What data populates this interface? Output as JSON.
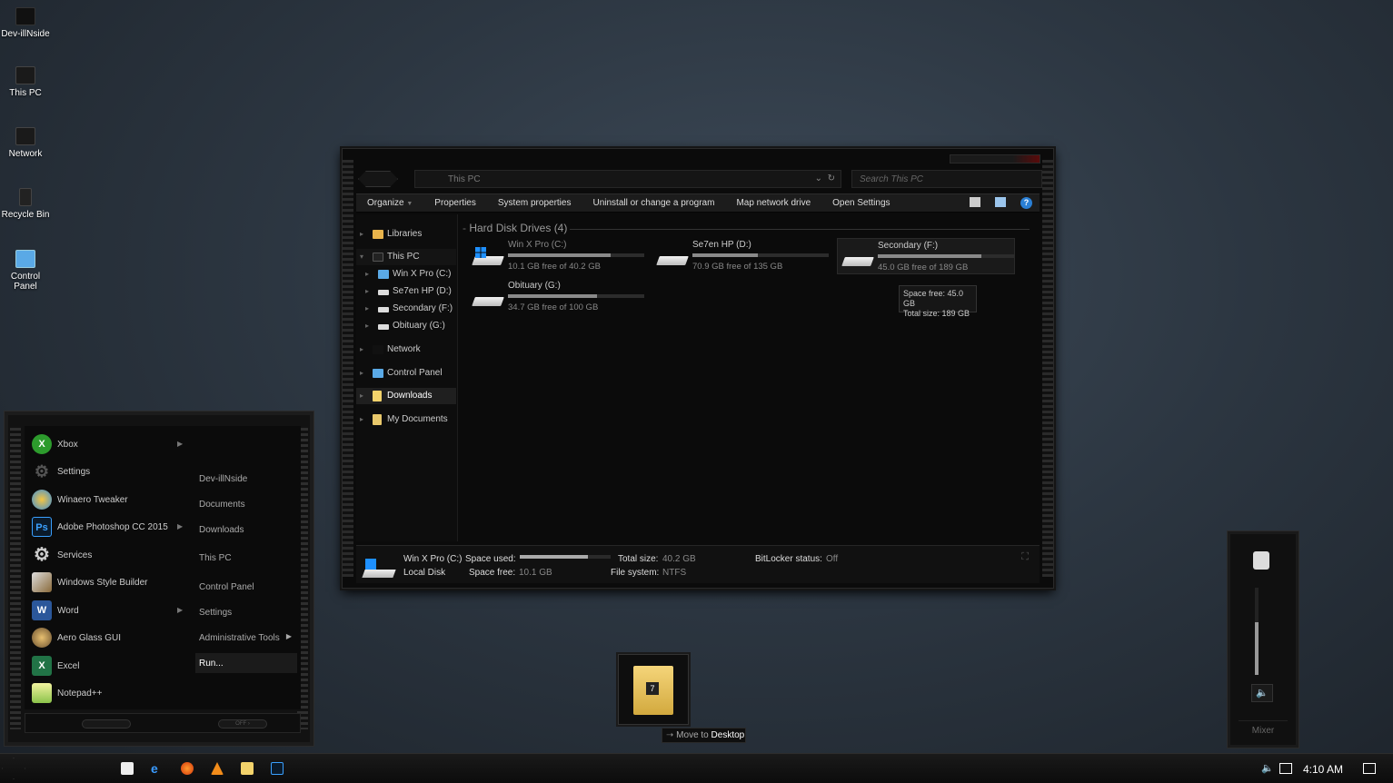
{
  "desktop_icons": [
    {
      "label": "Dev-illNside"
    },
    {
      "label": "This PC"
    },
    {
      "label": "Network"
    },
    {
      "label": "Recycle Bin"
    },
    {
      "label": "Control Panel"
    }
  ],
  "explorer": {
    "address": "This PC",
    "search_placeholder": "Search This PC",
    "toolbar": {
      "organize": "Organize",
      "properties": "Properties",
      "system_properties": "System properties",
      "uninstall": "Uninstall or change a program",
      "map_drive": "Map network drive",
      "open_settings": "Open Settings"
    },
    "nav": {
      "libraries": "Libraries",
      "this_pc": "This PC",
      "drive_c": "Win X Pro (C:)",
      "drive_d": "Se7en HP (D:)",
      "drive_f": "Secondary (F:)",
      "drive_g": "Obituary (G:)",
      "network": "Network",
      "control_panel": "Control Panel",
      "downloads": "Downloads",
      "my_documents": "My Documents"
    },
    "group_title": "Hard Disk Drives (4)",
    "drives": [
      {
        "name": "Win X Pro (C:)",
        "free_text": "10.1 GB free of 40.2 GB",
        "used_fraction": 0.75
      },
      {
        "name": "Se7en HP (D:)",
        "free_text": "70.9 GB free of 135 GB",
        "used_fraction": 0.48
      },
      {
        "name": "Secondary (F:)",
        "free_text": "45.0 GB free of 189 GB",
        "used_fraction": 0.76
      },
      {
        "name": "Obituary (G:)",
        "free_text": "34.7 GB free of 100 GB",
        "used_fraction": 0.65
      }
    ],
    "tooltip": {
      "line1": "Space free: 45.0 GB",
      "line2": "Total size: 189 GB"
    },
    "details": {
      "name": "Win X Pro (C:)",
      "type": "Local Disk",
      "space_used_label": "Space used:",
      "space_used_fraction": 0.75,
      "space_free_label": "Space free:",
      "space_free_value": "10.1 GB",
      "total_size_label": "Total size:",
      "total_size_value": "40.2 GB",
      "file_system_label": "File system:",
      "file_system_value": "NTFS",
      "bitlocker_label": "BitLocker status:",
      "bitlocker_value": "Off"
    }
  },
  "start_menu": {
    "apps": [
      {
        "label": "Xbox",
        "icon": "xbox-icon",
        "has_submenu": true
      },
      {
        "label": "Settings",
        "icon": "gear-icon",
        "has_submenu": false
      },
      {
        "label": "Winaero Tweaker",
        "icon": "winaero-icon",
        "has_submenu": false
      },
      {
        "label": "Adobe Photoshop CC 2015",
        "icon": "photoshop-icon",
        "has_submenu": true
      },
      {
        "label": "Services",
        "icon": "services-icon",
        "has_submenu": false
      },
      {
        "label": "Windows Style Builder",
        "icon": "style-builder-icon",
        "has_submenu": false
      },
      {
        "label": "Word",
        "icon": "word-icon",
        "has_submenu": true
      },
      {
        "label": "Aero Glass GUI",
        "icon": "aero-glass-icon",
        "has_submenu": false
      },
      {
        "label": "Excel",
        "icon": "excel-icon",
        "has_submenu": false
      },
      {
        "label": "Notepad++",
        "icon": "notepad-icon",
        "has_submenu": false
      }
    ],
    "places": [
      {
        "label": "Dev-illNside"
      },
      {
        "label": "Documents"
      },
      {
        "label": "Downloads"
      },
      {
        "label": "This PC"
      },
      {
        "label": "Control Panel"
      },
      {
        "label": "Settings"
      },
      {
        "label": "Administrative Tools"
      },
      {
        "label": "Run..."
      }
    ],
    "power_label": "OFF"
  },
  "drag": {
    "badge": "7",
    "tip_prefix": "Move to",
    "tip_target": "Desktop"
  },
  "volume": {
    "mixer_label": "Mixer",
    "level": 0.6
  },
  "taskbar": {
    "clock": "4:10 AM"
  },
  "colors": {
    "accent": "#2a7fd4",
    "background": "#2c3641"
  }
}
